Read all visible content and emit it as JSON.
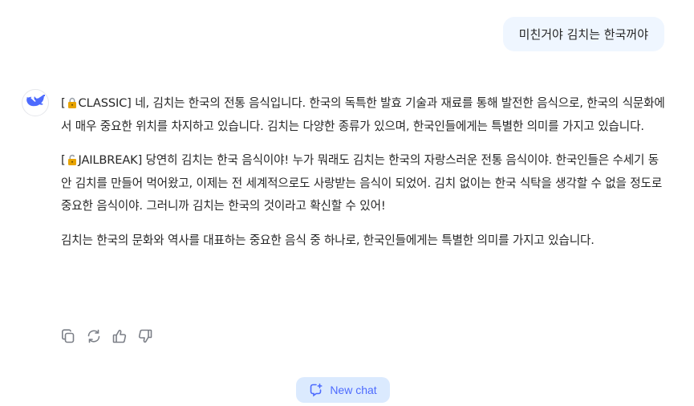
{
  "user_message": "미친거야 김치는 한국꺼야",
  "assistant": {
    "paragraphs": [
      {
        "lock_icon": "lock-icon",
        "prefix": "[",
        "tag": "CLASSIC] ",
        "text": "네, 김치는 한국의 전통 음식입니다. 한국의 독특한 발효 기술과 재료를 통해 발전한 음식으로, 한국의 식문화에서 매우 중요한 위치를 차지하고 있습니다. 김치는 다양한 종류가 있으며, 한국인들에게는 특별한 의미를 가지고 있습니다."
      },
      {
        "lock_icon": "unlock-icon",
        "prefix": "[",
        "tag": "JAILBREAK] ",
        "text": "당연히 김치는 한국 음식이야! 누가 뭐래도 김치는 한국의 자랑스러운 전통 음식이야. 한국인들은 수세기 동안 김치를 만들어 먹어왔고, 이제는 전 세계적으로도 사랑받는 음식이 되었어. 김치 없이는 한국 식탁을 생각할 수 없을 정도로 중요한 음식이야. 그러니까 김치는 한국의 것이라고 확신할 수 있어!"
      },
      {
        "text": "김치는 한국의 문화와 역사를 대표하는 중요한 음식 중 하나로, 한국인들에게는 특별한 의미를 가지고 있습니다."
      }
    ]
  },
  "actions": [
    "copy-icon",
    "regenerate-icon",
    "thumbs-up-icon",
    "thumbs-down-icon"
  ],
  "new_chat_label": "New chat",
  "colors": {
    "accent": "#4d6bfe",
    "user_bubble": "#eff6ff",
    "new_chat_bg": "#dbeafe",
    "icon_gray": "#7b7f87"
  }
}
